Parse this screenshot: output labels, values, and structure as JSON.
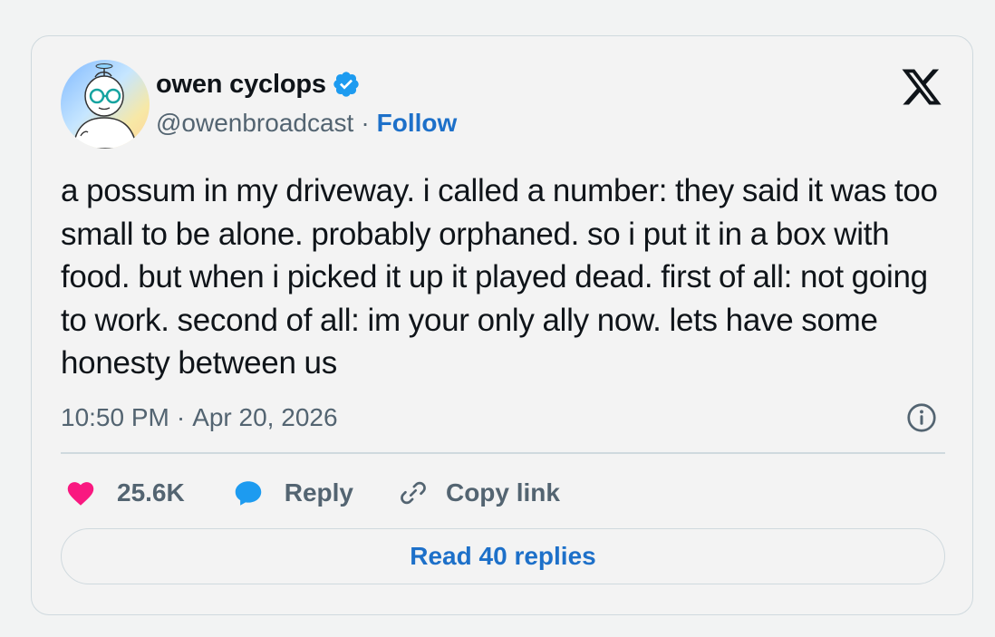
{
  "author": {
    "name": "owen cyclops",
    "handle": "@owenbroadcast",
    "separator": "·",
    "follow_label": "Follow"
  },
  "post": {
    "text": "a possum in my driveway. i called a number: they said it was too small to be alone. probably orphaned. so i put it in a box with food. but when i picked it up it played dead. first of all: not going to work. second of all: im your only ally now. lets have some honesty between us",
    "time": "10:50 PM",
    "separator": "·",
    "date": "Apr 20, 2026"
  },
  "actions": {
    "like_count": "25.6K",
    "reply_label": "Reply",
    "copy_label": "Copy link"
  },
  "read_replies_label": "Read 40 replies",
  "icons": {
    "logo": "x-logo-icon",
    "verified": "verified-badge-icon",
    "info": "info-icon",
    "like": "heart-icon",
    "reply": "speech-bubble-icon",
    "copy": "link-icon"
  },
  "colors": {
    "accent": "#1d70c9",
    "verified": "#1d9bf0",
    "like": "#f91880",
    "muted": "#536471",
    "text": "#0f1419",
    "border": "#cfd9de"
  }
}
